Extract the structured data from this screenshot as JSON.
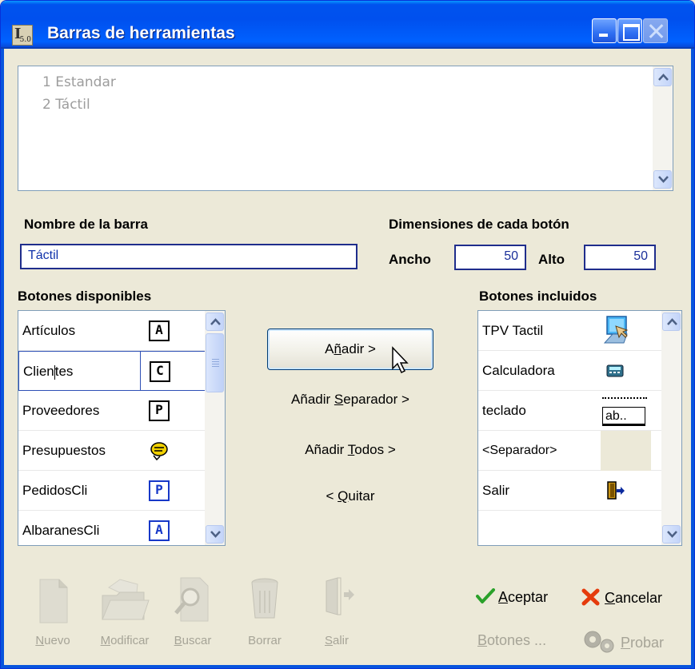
{
  "window": {
    "title": "Barras de herramientas",
    "app_icon_text": "5.0"
  },
  "toolbars_list": {
    "items": [
      "1 Estandar",
      "2 Táctil"
    ]
  },
  "toolbar_name": {
    "label": "Nombre de la barra",
    "value": "Táctil"
  },
  "dimensions": {
    "label": "Dimensiones de cada botón",
    "width_label": "Ancho",
    "width_value": "50",
    "height_label": "Alto",
    "height_value": "50"
  },
  "available": {
    "label": "Botones disponibles",
    "items": [
      {
        "name": "Artículos",
        "icon": "A",
        "icon_name": "articulos-icon"
      },
      {
        "name_a": "Clien",
        "name_b": "tes",
        "icon": "C",
        "icon_name": "clientes-icon"
      },
      {
        "name": "Proveedores",
        "icon": "P",
        "icon_name": "proveedores-icon"
      },
      {
        "name": "Presupuestos",
        "icon_name": "presupuestos-icon"
      },
      {
        "name": "PedidosCli",
        "icon": "P",
        "icon_name": "pedidos-cli-icon"
      },
      {
        "name": "AlbaranesCli",
        "icon": "A",
        "icon_name": "albaranes-cli-icon"
      }
    ]
  },
  "actions": {
    "add_pre": "A",
    "add_u": "ñ",
    "add_post": "adir >",
    "add_sep_pre": "Añadir ",
    "add_sep_u": "S",
    "add_sep_post": "eparador >",
    "add_all_pre": "Añadir ",
    "add_all_u": "T",
    "add_all_post": "odos >",
    "remove_pre": "< ",
    "remove_u": "Q",
    "remove_post": "uitar"
  },
  "included": {
    "label": "Botones incluidos",
    "items": [
      {
        "name": "TPV Tactil",
        "icon_name": "tpv-tactil-icon"
      },
      {
        "name": "Calculadora",
        "icon_name": "calculator-icon"
      },
      {
        "name": "teclado",
        "icon_name": "keyboard-icon",
        "icon_text": "ab.."
      },
      {
        "name": "<Separador>",
        "icon_name": "separator-blank"
      },
      {
        "name": "Salir",
        "icon_name": "exit-door-icon"
      }
    ]
  },
  "bottom_tools": {
    "new_u": "N",
    "new_rest": "uevo",
    "modify_u": "M",
    "modify_rest": "odificar",
    "search_u": "B",
    "search_rest": "uscar",
    "delete": "Borrar",
    "exit_u": "S",
    "exit_rest": "alir"
  },
  "commands": {
    "accept_u": "A",
    "accept_rest": "ceptar",
    "cancel_u": "C",
    "cancel_rest": "ancelar",
    "buttons_u": "B",
    "buttons_rest": "otones ...",
    "test_u": "P",
    "test_rest": "robar"
  }
}
